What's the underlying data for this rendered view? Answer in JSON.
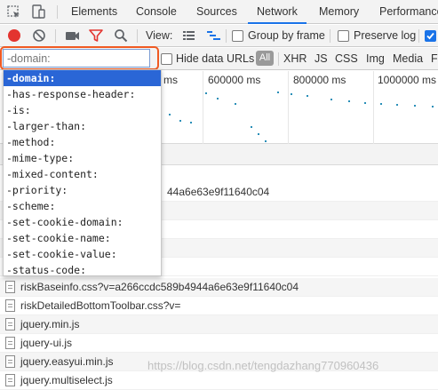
{
  "tabs": [
    {
      "label": "Elements",
      "active": false
    },
    {
      "label": "Console",
      "active": false
    },
    {
      "label": "Sources",
      "active": false
    },
    {
      "label": "Network",
      "active": true
    },
    {
      "label": "Memory",
      "active": false
    },
    {
      "label": "Performance",
      "active": false
    }
  ],
  "toolbar": {
    "view_label": "View:",
    "group_by_frame_label": "Group by frame",
    "group_by_frame_checked": false,
    "preserve_log_label": "Preserve log",
    "preserve_log_checked": false,
    "trailing_checkbox_checked": true
  },
  "filter": {
    "value": "",
    "placeholder": "-domain:",
    "hide_data_urls_label": "Hide data URLs",
    "hide_data_urls_checked": false,
    "all_label": "All",
    "types": [
      "XHR",
      "JS",
      "CSS",
      "Img",
      "Media",
      "Fo"
    ]
  },
  "timeline": {
    "ticks": [
      "ms",
      "600000 ms",
      "800000 ms",
      "1000000 ms"
    ]
  },
  "autocomplete": {
    "items": [
      "-domain:",
      "-has-response-header:",
      "-is:",
      "-larger-than:",
      "-method:",
      "-mime-type:",
      "-mixed-content:",
      "-priority:",
      "-scheme:",
      "-set-cookie-domain:",
      "-set-cookie-name:",
      "-set-cookie-value:",
      "-status-code:"
    ],
    "selected_index": 0
  },
  "requests": {
    "partial_hash_text": "44a6e63e9f11640c04",
    "rows": [
      "riskBaseinfo.css?v=a266ccdc589b4944a6e63e9f11640c04",
      "riskDetailedBottomToolbar.css?v=",
      "jquery.min.js",
      "jquery-ui.js",
      "jquery.easyui.min.js",
      "jquery.multiselect.js"
    ]
  },
  "watermark": "https://blog.csdn.net/tengdazhang770960436",
  "colors": {
    "accent": "#1a73e8",
    "record_red": "#e3342f",
    "highlight_orange": "#f05a22",
    "selection_blue": "#2a66d6"
  }
}
